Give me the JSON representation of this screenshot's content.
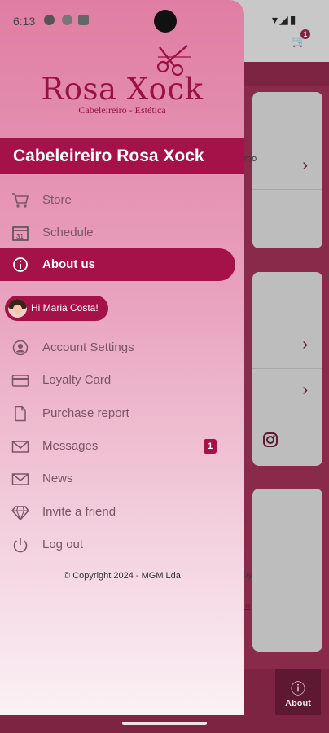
{
  "status": {
    "time": "6:13"
  },
  "background": {
    "cart_badge": "1",
    "card1_text": "mo",
    "card3_text": "k by",
    "card3_link": "om",
    "bottom_tab_label": "About"
  },
  "drawer": {
    "logo_name": "Rosa Xock",
    "logo_subtitle": "Cabeleireiro - Estética",
    "title": "Cabeleireiro Rosa Xock",
    "top_items": [
      {
        "label": "Store",
        "icon": "cart-icon"
      },
      {
        "label": "Schedule",
        "icon": "calendar-icon"
      },
      {
        "label": "About us",
        "icon": "info-icon",
        "active": true
      }
    ],
    "greeting": "Hi Maria Costa!",
    "account_items": [
      {
        "label": "Account Settings",
        "icon": "account-icon"
      },
      {
        "label": "Loyalty Card",
        "icon": "card-icon"
      },
      {
        "label": "Purchase report",
        "icon": "document-icon"
      },
      {
        "label": "Messages",
        "icon": "mail-icon",
        "badge": "1"
      },
      {
        "label": "News",
        "icon": "mail-icon"
      },
      {
        "label": "Invite a friend",
        "icon": "diamond-icon"
      },
      {
        "label": "Log out",
        "icon": "power-icon"
      }
    ],
    "copyright": "© Copyright 2024 - MGM Lda"
  },
  "colors": {
    "accent": "#a5124a",
    "drawer_top": "#e07ea2",
    "drawer_bottom": "#fbf1f5"
  }
}
